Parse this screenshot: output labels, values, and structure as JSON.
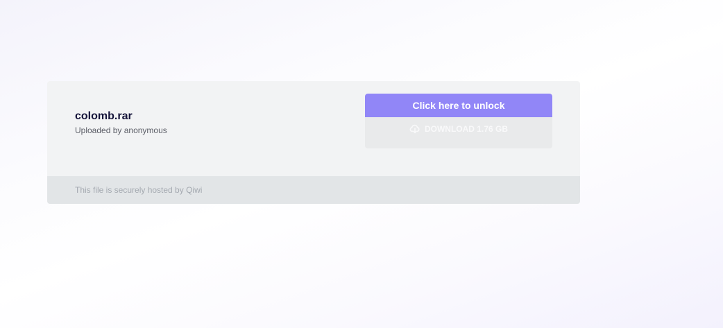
{
  "file": {
    "name": "colomb.rar",
    "uploader": "Uploaded by anonymous"
  },
  "actions": {
    "unlock_label": "Click here to unlock",
    "download_label": "DOWNLOAD 1.76 GB",
    "download_icon": "cloud-download-icon"
  },
  "footer": {
    "text": "This file is securely hosted by Qiwi"
  },
  "colors": {
    "accent": "#9186f7",
    "card_background": "#f2f3f4",
    "footer_background": "#e2e5e7",
    "title_text": "#15143a"
  }
}
